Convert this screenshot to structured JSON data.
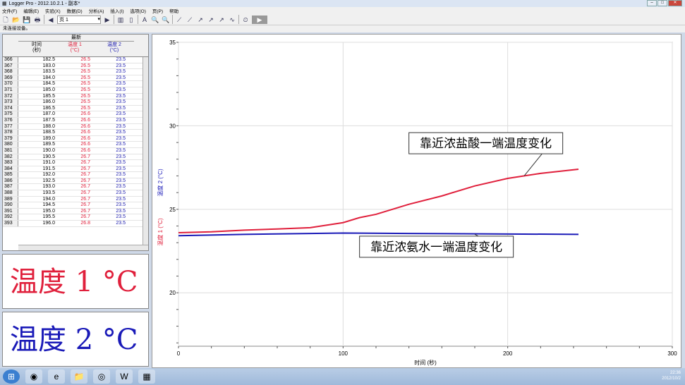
{
  "window": {
    "title": "Logger Pro - 2012.10.2.1 - 副本*"
  },
  "menu": [
    "文件(F)",
    "编辑(E)",
    "实验(X)",
    "数据(D)",
    "分析(A)",
    "插入(I)",
    "选项(O)",
    "页(P)",
    "帮助"
  ],
  "toolbar": {
    "page": "页 1"
  },
  "status": "未连接设备。",
  "table": {
    "group": "最新",
    "headers": [
      {
        "name": "时间",
        "unit": "(秒)"
      },
      {
        "name": "温度 1",
        "unit": "(°C)"
      },
      {
        "name": "温度 2",
        "unit": "(°C)"
      }
    ],
    "rows": [
      [
        "366",
        "182.5",
        "26.5",
        "23.5"
      ],
      [
        "367",
        "183.0",
        "26.5",
        "23.5"
      ],
      [
        "368",
        "183.5",
        "26.5",
        "23.5"
      ],
      [
        "369",
        "184.0",
        "26.5",
        "23.5"
      ],
      [
        "370",
        "184.5",
        "26.5",
        "23.5"
      ],
      [
        "371",
        "185.0",
        "26.5",
        "23.5"
      ],
      [
        "372",
        "185.5",
        "26.5",
        "23.5"
      ],
      [
        "373",
        "186.0",
        "26.5",
        "23.5"
      ],
      [
        "374",
        "186.5",
        "26.5",
        "23.5"
      ],
      [
        "375",
        "187.0",
        "26.6",
        "23.5"
      ],
      [
        "376",
        "187.5",
        "26.6",
        "23.5"
      ],
      [
        "377",
        "188.0",
        "26.6",
        "23.5"
      ],
      [
        "378",
        "188.5",
        "26.6",
        "23.5"
      ],
      [
        "379",
        "189.0",
        "26.6",
        "23.5"
      ],
      [
        "380",
        "189.5",
        "26.6",
        "23.5"
      ],
      [
        "381",
        "190.0",
        "26.6",
        "23.5"
      ],
      [
        "382",
        "190.5",
        "26.7",
        "23.5"
      ],
      [
        "383",
        "191.0",
        "26.7",
        "23.5"
      ],
      [
        "384",
        "191.5",
        "26.7",
        "23.5"
      ],
      [
        "385",
        "192.0",
        "26.7",
        "23.5"
      ],
      [
        "386",
        "192.5",
        "26.7",
        "23.5"
      ],
      [
        "387",
        "193.0",
        "26.7",
        "23.5"
      ],
      [
        "388",
        "193.5",
        "26.7",
        "23.5"
      ],
      [
        "389",
        "194.0",
        "26.7",
        "23.5"
      ],
      [
        "390",
        "194.5",
        "26.7",
        "23.5"
      ],
      [
        "391",
        "195.0",
        "26.7",
        "23.5"
      ],
      [
        "392",
        "195.5",
        "26.7",
        "23.5"
      ],
      [
        "393",
        "196.0",
        "26.8",
        "23.5"
      ]
    ]
  },
  "meters": [
    {
      "label": "温度 1",
      "unit": "°C",
      "color": "#e0203c"
    },
    {
      "label": "温度 2",
      "unit": "°C",
      "color": "#1a1ab8"
    }
  ],
  "chart_data": {
    "type": "line",
    "xlabel": "时间 (秒)",
    "ylabel1": "温度 1 (°C)",
    "ylabel2": "温度 2 (°C)",
    "xlim": [
      0,
      300
    ],
    "ylim": [
      16.8,
      35
    ],
    "xticks": [
      0,
      100,
      200,
      300
    ],
    "yticks": [
      20,
      25,
      30,
      35
    ],
    "series": [
      {
        "name": "温度 1",
        "color": "#e0203c",
        "x": [
          0,
          20,
          40,
          60,
          80,
          100,
          110,
          120,
          140,
          160,
          180,
          200,
          220,
          243
        ],
        "y": [
          23.6,
          23.65,
          23.75,
          23.82,
          23.9,
          24.2,
          24.5,
          24.7,
          25.3,
          25.8,
          26.4,
          26.85,
          27.15,
          27.4
        ]
      },
      {
        "name": "温度 2",
        "color": "#1a1ab8",
        "x": [
          0,
          40,
          80,
          100,
          140,
          200,
          243
        ],
        "y": [
          23.42,
          23.5,
          23.55,
          23.58,
          23.55,
          23.52,
          23.5
        ]
      }
    ],
    "annotations": [
      {
        "text": "靠近浓盐酸一端温度变化",
        "x": 230,
        "y": 29.0,
        "target_x": 210,
        "target_y": 27.0
      },
      {
        "text": "靠近浓氨水一端温度变化",
        "x": 200,
        "y": 22.8,
        "target_x": 180,
        "target_y": 23.5
      }
    ]
  },
  "tray": {
    "time": "22:36",
    "date": "2012/10/2"
  }
}
